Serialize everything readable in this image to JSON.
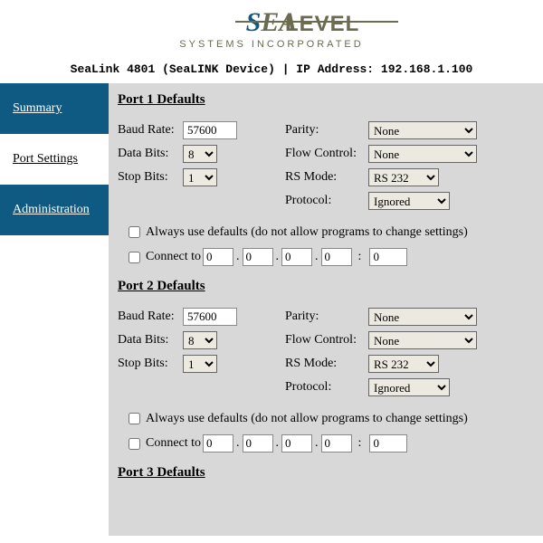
{
  "logo": {
    "brand_top": "SEALEVEL",
    "brand_sub": "SYSTEMS INCORPORATED"
  },
  "device_line": "SeaLink 4801 (SeaLINK Device) | IP Address: 192.168.1.100",
  "sidebar": {
    "items": [
      {
        "label": "Summary"
      },
      {
        "label": "Port Settings"
      },
      {
        "label": "Administration"
      }
    ]
  },
  "labels": {
    "baud_rate": "Baud Rate:",
    "data_bits": "Data Bits:",
    "stop_bits": "Stop Bits:",
    "parity": "Parity:",
    "flow_control": "Flow Control:",
    "rs_mode": "RS Mode:",
    "protocol": "Protocol:",
    "always_defaults": "Always use defaults (do not allow programs to change settings)",
    "connect_to": "Connect to"
  },
  "ports": [
    {
      "heading": "Port 1 Defaults",
      "baud_rate": "57600",
      "data_bits": "8",
      "stop_bits": "1",
      "parity": "None",
      "flow_control": "None",
      "rs_mode": "RS 232",
      "protocol": "Ignored",
      "always_defaults": false,
      "connect_enabled": false,
      "ip": [
        "0",
        "0",
        "0",
        "0"
      ],
      "port": "0"
    },
    {
      "heading": "Port 2 Defaults",
      "baud_rate": "57600",
      "data_bits": "8",
      "stop_bits": "1",
      "parity": "None",
      "flow_control": "None",
      "rs_mode": "RS 232",
      "protocol": "Ignored",
      "always_defaults": false,
      "connect_enabled": false,
      "ip": [
        "0",
        "0",
        "0",
        "0"
      ],
      "port": "0"
    },
    {
      "heading": "Port 3 Defaults"
    }
  ]
}
